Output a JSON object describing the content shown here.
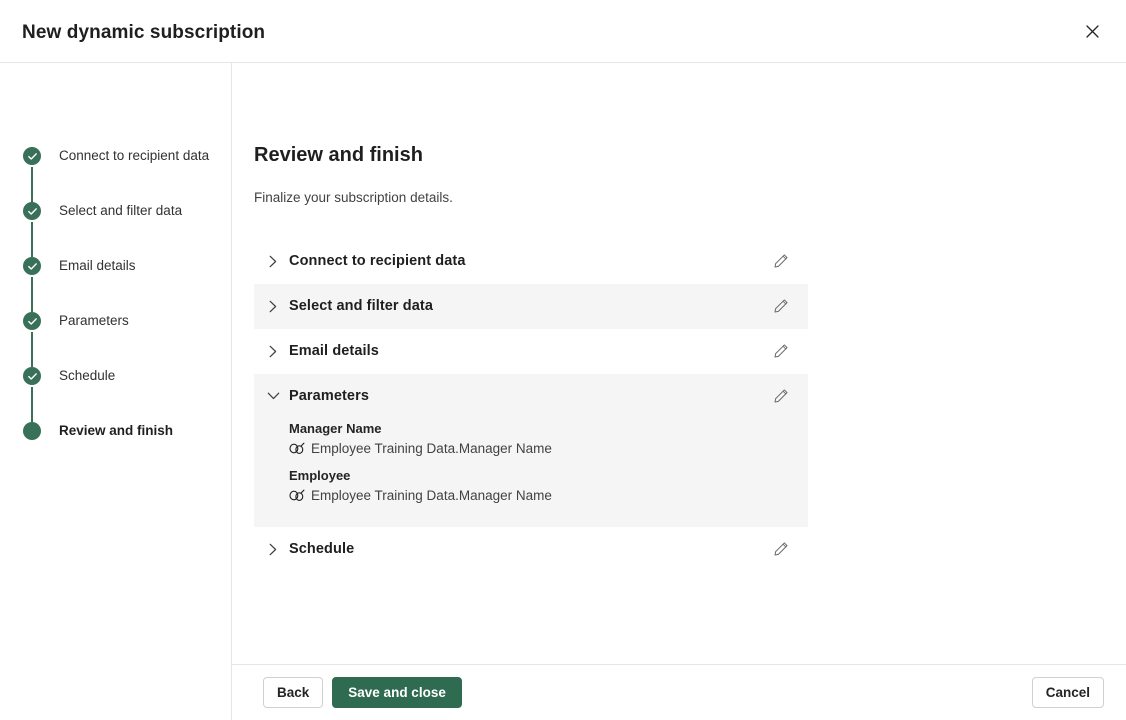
{
  "dialog": {
    "title": "New dynamic subscription",
    "close_label": "Close"
  },
  "sidebar": {
    "steps": [
      {
        "label": "Connect to recipient data",
        "state": "completed"
      },
      {
        "label": "Select and filter data",
        "state": "completed"
      },
      {
        "label": "Email details",
        "state": "completed"
      },
      {
        "label": "Parameters",
        "state": "completed"
      },
      {
        "label": "Schedule",
        "state": "completed"
      },
      {
        "label": "Review and finish",
        "state": "current"
      }
    ]
  },
  "main": {
    "title": "Review and finish",
    "subtitle": "Finalize your subscription details.",
    "sections": [
      {
        "title": "Connect to recipient data",
        "expanded": false,
        "striped": false,
        "edit_label": "Edit"
      },
      {
        "title": "Select and filter data",
        "expanded": false,
        "striped": true,
        "edit_label": "Edit"
      },
      {
        "title": "Email details",
        "expanded": false,
        "striped": false,
        "edit_label": "Edit"
      },
      {
        "title": "Parameters",
        "expanded": true,
        "striped": true,
        "edit_label": "Edit",
        "parameters": [
          {
            "label": "Manager Name",
            "value": "Employee Training Data.Manager Name"
          },
          {
            "label": "Employee",
            "value": "Employee Training Data.Manager Name"
          }
        ]
      },
      {
        "title": "Schedule",
        "expanded": false,
        "striped": false,
        "edit_label": "Edit"
      }
    ]
  },
  "footer": {
    "back_label": "Back",
    "save_label": "Save and close",
    "cancel_label": "Cancel"
  },
  "colors": {
    "accent_green": "#2f6b50",
    "step_green": "#39705a",
    "stripe": "#f5f5f5",
    "border": "#e6e6e6"
  }
}
